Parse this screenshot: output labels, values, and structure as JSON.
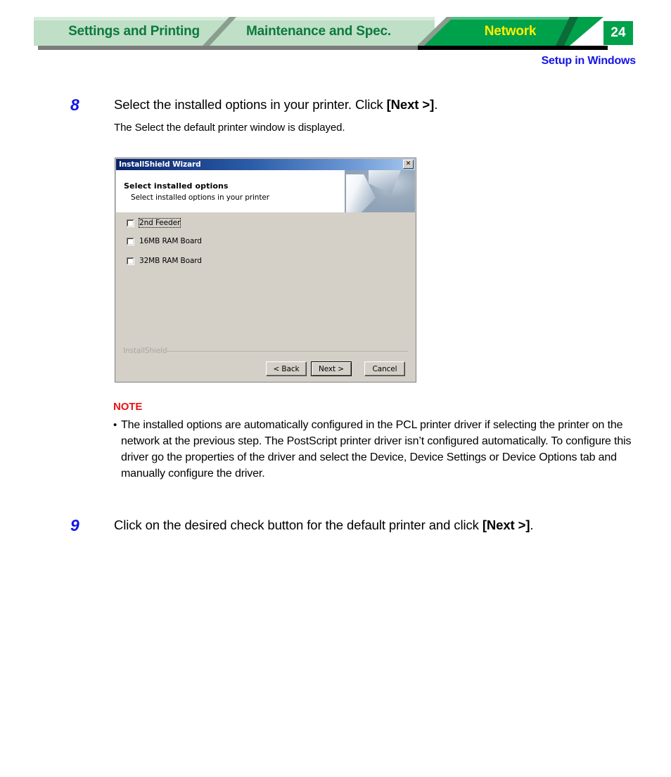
{
  "header": {
    "tabs": [
      {
        "label": "Settings and Printing",
        "active": false
      },
      {
        "label": "Maintenance and Spec.",
        "active": false
      },
      {
        "label": "Network",
        "active": true
      }
    ],
    "page_number": "24",
    "subtitle": "Setup in Windows",
    "colors": {
      "tab_inactive_bg": "#bfdfc6",
      "tab_inactive_text": "#0b7a3d",
      "tab_active_bg": "#00a14b",
      "tab_active_text": "#ffee00",
      "page_box_bg": "#00a14b",
      "subtitle_text": "#1414e6"
    }
  },
  "steps": [
    {
      "number": "8",
      "title_prefix": "Select the installed options in your printer. Click ",
      "title_bold": "[Next >]",
      "title_suffix": ".",
      "subtext": "The Select the default printer window is displayed."
    },
    {
      "number": "9",
      "title_prefix": "Click on the desired check button for the default printer and click ",
      "title_bold": "[Next >]",
      "title_suffix": "."
    }
  ],
  "dialog": {
    "title": "InstallShield Wizard",
    "close_icon": "✕",
    "banner": {
      "heading": "Select installed options",
      "subheading": "Select installed options in your printer"
    },
    "checkboxes": [
      {
        "label": "2nd Feeder",
        "checked": false,
        "focused": true
      },
      {
        "label": "16MB RAM Board",
        "checked": false,
        "focused": false
      },
      {
        "label": "32MB RAM Board",
        "checked": false,
        "focused": false
      }
    ],
    "footer_label": "InstallShield",
    "buttons": [
      {
        "label": "< Back",
        "default": false
      },
      {
        "label": "Next >",
        "default": true
      },
      {
        "label": "Cancel",
        "default": false
      }
    ]
  },
  "note": {
    "title": "NOTE",
    "bullet": "•",
    "text": "The installed options are automatically configured in the PCL printer driver if selecting the printer on the network at the previous step.  The PostScript printer driver isn’t configured automatically.  To configure this driver go the properties of the driver and select the Device, Device Settings or Device Options tab and manually configure the driver.",
    "title_color": "#ee1111"
  }
}
